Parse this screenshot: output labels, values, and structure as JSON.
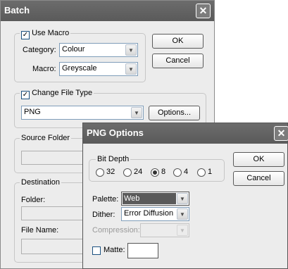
{
  "batch": {
    "title": "Batch",
    "use_macro_label": "Use Macro",
    "category_label": "Category:",
    "category_value": "Colour",
    "macro_label": "Macro:",
    "macro_value": "Greyscale",
    "ok_label": "OK",
    "cancel_label": "Cancel",
    "change_file_type_label": "Change File Type",
    "file_type_value": "PNG",
    "options_label": "Options...",
    "source_folder_label": "Source Folder",
    "destination_label": "Destination",
    "folder_label": "Folder:",
    "file_name_label": "File Name:"
  },
  "png_options": {
    "title": "PNG Options",
    "bit_depth_label": "Bit Depth",
    "bit_depth_options": [
      "32",
      "24",
      "8",
      "4",
      "1"
    ],
    "bit_depth_selected": "8",
    "ok_label": "OK",
    "cancel_label": "Cancel",
    "palette_label": "Palette:",
    "palette_value": "Web",
    "dither_label": "Dither:",
    "dither_value": "Error Diffusion",
    "compression_label": "Compression:",
    "compression_value": "",
    "matte_label": "Matte:"
  },
  "icons": {
    "close": "close-icon",
    "dropdown": "chevron-down-icon",
    "check": "checkmark-icon"
  },
  "colors": {
    "titlebar": "#5f5f5f",
    "dialog_bg": "#ececec",
    "selected_field": "#5a5a5a"
  }
}
